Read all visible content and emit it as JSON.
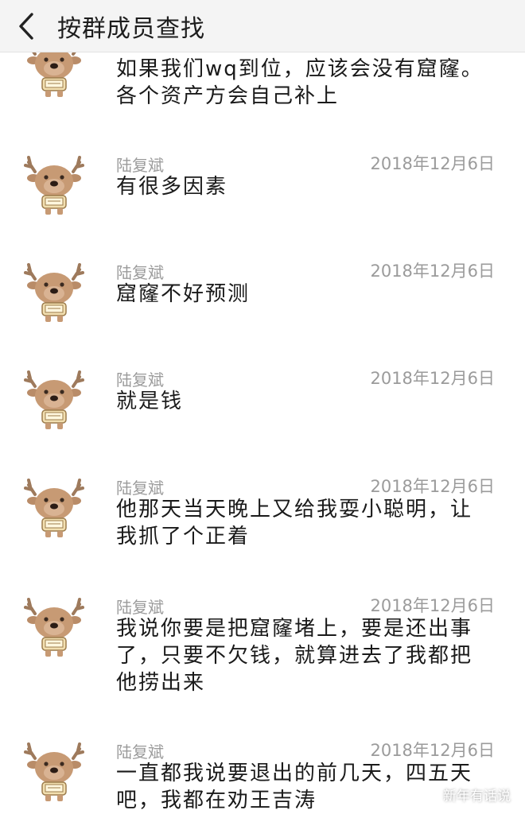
{
  "header": {
    "title": "按群成员查找",
    "back_icon": "chevron-left-icon"
  },
  "messages": [
    {
      "name": "",
      "date": "",
      "text": "如果我们wq到位，应该会没有窟窿。各个资产方会自己补上"
    },
    {
      "name": "陆复斌",
      "date": "2018年12月6日",
      "text": "有很多因素"
    },
    {
      "name": "陆复斌",
      "date": "2018年12月6日",
      "text": "窟窿不好预测"
    },
    {
      "name": "陆复斌",
      "date": "2018年12月6日",
      "text": "就是钱"
    },
    {
      "name": "陆复斌",
      "date": "2018年12月6日",
      "text": "他那天当天晚上又给我耍小聪明，让我抓了个正着"
    },
    {
      "name": "陆复斌",
      "date": "2018年12月6日",
      "text": "我说你要是把窟窿堵上，要是还出事了，只要不欠钱，就算进去了我都把他捞出来"
    },
    {
      "name": "陆复斌",
      "date": "2018年12月6日",
      "text": "一直都我说要退出的前几天，四五天吧，我都在劝王吉涛"
    }
  ],
  "watermark": {
    "text": "新年有话说",
    "icon": "wechat-icon"
  },
  "colors": {
    "header_bg": "#f4f4f4",
    "meta_text": "#9b9b9b",
    "body_text": "#1a1a1a"
  }
}
